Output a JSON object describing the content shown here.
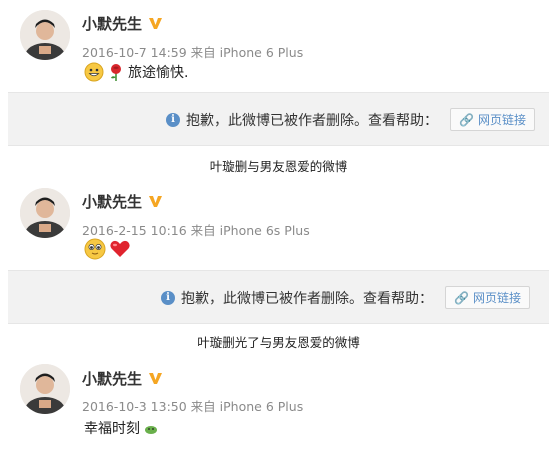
{
  "posts": [
    {
      "username": "小默先生",
      "timestamp": "2016-10-7 14:59",
      "source_prefix": "来自",
      "device": "iPhone 6 Plus",
      "content": "旅途愉快."
    },
    {
      "username": "小默先生",
      "timestamp": "2016-2-15 10:16",
      "source_prefix": "来自",
      "device": "iPhone 6s Plus",
      "content": ""
    },
    {
      "username": "小默先生",
      "timestamp": "2016-10-3 13:50",
      "source_prefix": "来自",
      "device": "iPhone 6 Plus",
      "content": "幸福时刻"
    }
  ],
  "deleted_notice": {
    "info_icon": "info-icon",
    "message": "抱歉，此微博已被作者删除。查看帮助：",
    "link_label": "网页链接",
    "link_icon": "chain-link-icon"
  },
  "captions": [
    "叶璇删与男友恩爱的微博",
    "叶璇删光了与男友恩爱的微博"
  ],
  "colors": {
    "verified_badge": "#f5a623",
    "link_blue": "#5a8fc7",
    "meta_gray": "#8a8a8a",
    "deleted_bg": "#f2f2f2"
  }
}
